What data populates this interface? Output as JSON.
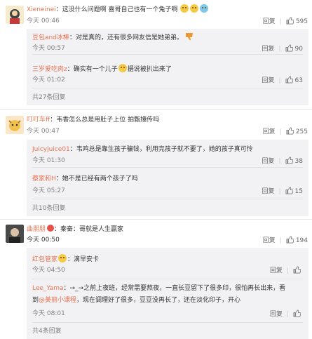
{
  "labels": {
    "reply": "回复",
    "separator": "|"
  },
  "threads": [
    {
      "user": "Xieneinei",
      "text": "：这没什么问题啊 喜哥自己也有一个兔子啊",
      "time": "今天 00:46",
      "likes": "595",
      "replies": [
        {
          "user": "豆包and冰棒",
          "text": "：对是真的，还有很多网友信是她弟弟。",
          "time": "今天 00:57",
          "likes": "90"
        },
        {
          "user": "三岁爱吃肉z",
          "text_before": "：确实有一个儿子",
          "text_after": "据说被扒出来了",
          "time": "今天 01:02",
          "likes": "63"
        }
      ],
      "more": "共27条回复"
    },
    {
      "user": "叮叮车ff",
      "text": "：韦香怎么总是用肚子上位 拍甄嬛传吗",
      "time": "今天 00:47",
      "likes": "255",
      "replies": [
        {
          "user": "Juicyjuice01",
          "text": "：韦鸡总是靠生孩子骗钱，利用完孩子就不要了，她的孩子真可怜",
          "time": "今天 01:30",
          "likes": "38"
        },
        {
          "user": "蔡家和H",
          "text": "：她不是已经有两个孩子了吗",
          "time": "今天 05:27",
          "likes": "15"
        }
      ],
      "more": "共10条回复"
    },
    {
      "user": "曲朋朋",
      "text": "：秦奋：哥就是人生赢家",
      "time": "今天 00:50",
      "likes": "194",
      "replies": [
        {
          "user": "红包管家",
          "text": "：滴早安卡",
          "time": "今天 04:50",
          "likes": ""
        },
        {
          "user": "Lee_Yama",
          "text_line1": "：→_→之前上夜班，经常需要熬夜，一直长豆留下了很多印，很怕再长出来，看",
          "text_line2_before": "到",
          "mention": "@美丽小课程",
          "text_line2_after": "，现在调理好了很多，豆豆没再长了，还在淡化印子，开心",
          "time": "今天 08:01",
          "likes": ""
        }
      ],
      "more": "共4条回复"
    }
  ],
  "icons": {
    "like": "thumbs-up-icon",
    "dislike": "thumbs-down-icon",
    "emoji": "emoji-icon",
    "vip": "vip-badge-icon"
  }
}
